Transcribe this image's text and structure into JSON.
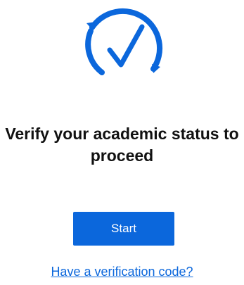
{
  "hero": {
    "icon": "circular-checkmark-icon"
  },
  "message": {
    "heading": "Verify your academic status to proceed"
  },
  "actions": {
    "start_label": "Start",
    "verification_code_link": "Have a verification code?"
  },
  "colors": {
    "accent": "#0b67dc",
    "text": "#111111",
    "background": "#ffffff"
  }
}
